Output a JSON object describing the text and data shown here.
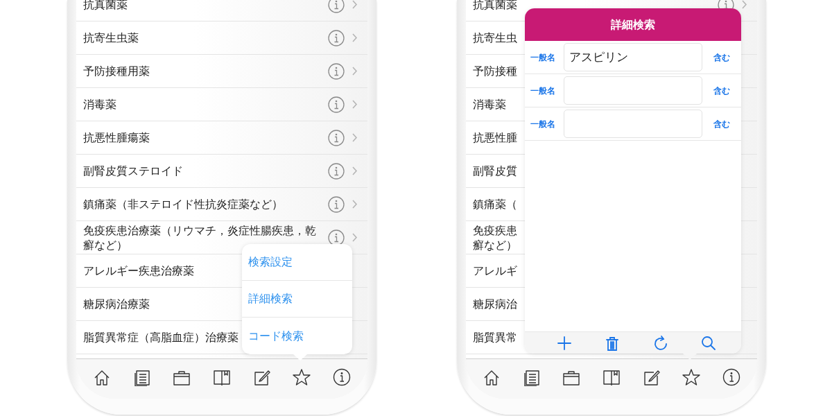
{
  "phones": [
    {
      "list": [
        {
          "label": "抗真菌薬",
          "accessory": true
        },
        {
          "label": "抗寄生虫薬",
          "accessory": true
        },
        {
          "label": "予防接種用薬",
          "accessory": true
        },
        {
          "label": "消毒薬",
          "accessory": true
        },
        {
          "label": "抗悪性腫瘍薬",
          "accessory": true
        },
        {
          "label": "副腎皮質ステロイド",
          "accessory": true
        },
        {
          "label": "鎮痛薬（非ステロイド性抗炎症薬など）",
          "accessory": true
        },
        {
          "label": "免疫疾患治療薬（リウマチ，炎症性腸疾患，乾癬など）",
          "accessory": true
        },
        {
          "label": "アレルギー疾患治療薬",
          "accessory": false
        },
        {
          "label": "糖尿病治療薬",
          "accessory": false
        },
        {
          "label": "脂質異常症（高脂血症）治療薬",
          "accessory": false
        }
      ],
      "popover": {
        "items": [
          "検索設定",
          "詳細検索",
          "コード検索"
        ]
      }
    },
    {
      "list": [
        {
          "label": "抗真菌薬",
          "accessory": true
        },
        {
          "label": "抗寄生虫",
          "accessory": false
        },
        {
          "label": "予防接種",
          "accessory": false
        },
        {
          "label": "消毒薬",
          "accessory": false
        },
        {
          "label": "抗悪性腫",
          "accessory": false
        },
        {
          "label": "副腎皮質",
          "accessory": false
        },
        {
          "label": "鎮痛薬（",
          "accessory": false
        },
        {
          "lines": [
            "免疫疾患",
            "癬など）"
          ],
          "accessory": false
        },
        {
          "label": "アレルギ",
          "accessory": false
        },
        {
          "label": "糖尿病治",
          "accessory": false
        },
        {
          "label": "脂質異常",
          "accessory": false
        }
      ],
      "panel": {
        "title": "詳細検索",
        "rows": [
          {
            "label": "一般名",
            "value": "アスピリン",
            "mode": "含む"
          },
          {
            "label": "一般名",
            "mode": "含む"
          },
          {
            "label": "一般名",
            "mode": "含む"
          }
        ]
      }
    }
  ]
}
